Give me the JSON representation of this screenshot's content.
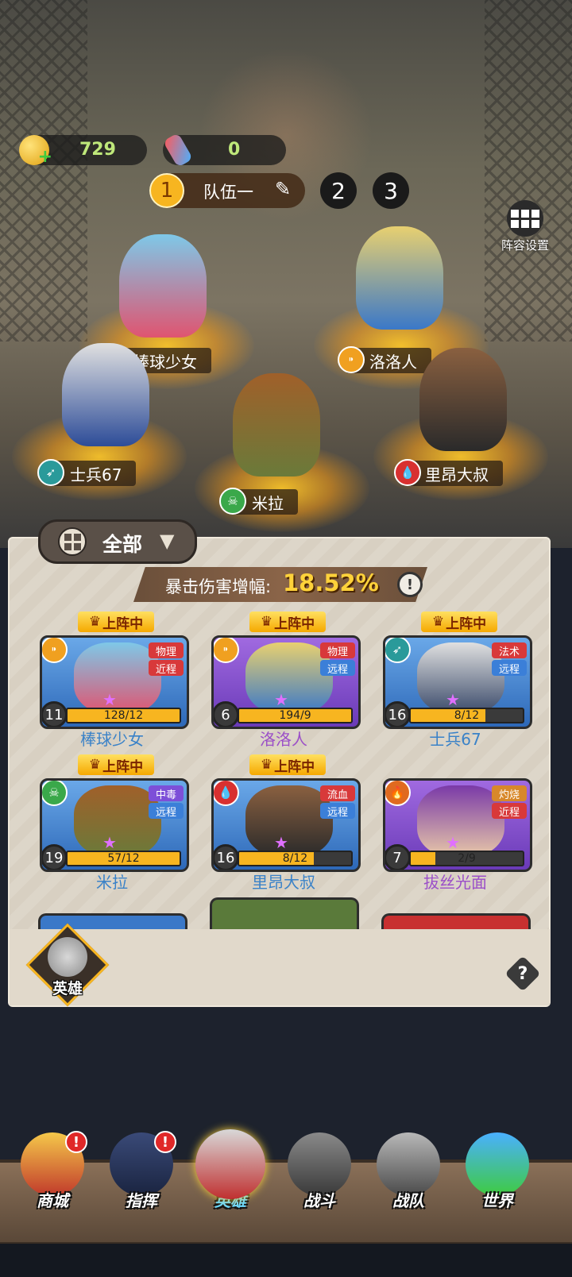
{
  "resources": {
    "coins": "729",
    "potions": "0"
  },
  "teams": {
    "active_num": "1",
    "active_label": "队伍一",
    "other": [
      "2",
      "3"
    ]
  },
  "lineup_settings_label": "阵容设置",
  "formation": [
    {
      "name": "棒球少女",
      "class_icon": "none"
    },
    {
      "name": "洛洛人",
      "class_icon": "bullet-icon"
    },
    {
      "name": "士兵67",
      "class_icon": "bow-arrow-icon"
    },
    {
      "name": "米拉",
      "class_icon": "skull-icon"
    },
    {
      "name": "里昂大叔",
      "class_icon": "blood-drop-icon"
    }
  ],
  "filter": {
    "label": "全部"
  },
  "crit_bonus": {
    "label": "暴击伤害增幅:",
    "value": "18.52%"
  },
  "deployed_label": "上阵中",
  "heroes": [
    {
      "name": "棒球少女",
      "level": "11",
      "progress": "128/12",
      "fill": 1.0,
      "tags": [
        "物理",
        "近程"
      ],
      "deployed": true,
      "name_color": "#3a82c8",
      "frame": "blue"
    },
    {
      "name": "洛洛人",
      "level": "6",
      "progress": "194/9",
      "fill": 1.0,
      "tags": [
        "物理",
        "远程"
      ],
      "deployed": true,
      "name_color": "#9b4fc8",
      "frame": "purple"
    },
    {
      "name": "士兵67",
      "level": "16",
      "progress": "8/12",
      "fill": 0.67,
      "tags": [
        "法术",
        "远程"
      ],
      "deployed": true,
      "name_color": "#3a82c8",
      "frame": "blue"
    },
    {
      "name": "米拉",
      "level": "19",
      "progress": "57/12",
      "fill": 1.0,
      "tags": [
        "中毒",
        "远程"
      ],
      "deployed": true,
      "name_color": "#3a82c8",
      "frame": "blue"
    },
    {
      "name": "里昂大叔",
      "level": "16",
      "progress": "8/12",
      "fill": 0.67,
      "tags": [
        "流血",
        "远程"
      ],
      "deployed": true,
      "name_color": "#3a82c8",
      "frame": "blue"
    },
    {
      "name": "拔丝光面",
      "level": "7",
      "progress": "2/9",
      "fill": 0.22,
      "tags": [
        "灼烧",
        "近程"
      ],
      "deployed": false,
      "name_color": "#9b4fc8",
      "frame": "purple"
    }
  ],
  "hero_tab_label": "英雄",
  "help": "?",
  "nav": [
    {
      "label": "商城",
      "alert": "!"
    },
    {
      "label": "指挥",
      "alert": "!"
    },
    {
      "label": "英雄",
      "alert": ""
    },
    {
      "label": "战斗",
      "alert": ""
    },
    {
      "label": "战队",
      "alert": ""
    },
    {
      "label": "世界",
      "alert": ""
    }
  ],
  "colors": {
    "accent_gold": "#f7b520",
    "panel": "#d8d0c2",
    "deployed_gold": "#ffd23a",
    "tag_red": "#d8393a",
    "tag_blue": "#3b7fd8",
    "tag_purple": "#7d4fd8",
    "tag_orange": "#d8882a"
  }
}
